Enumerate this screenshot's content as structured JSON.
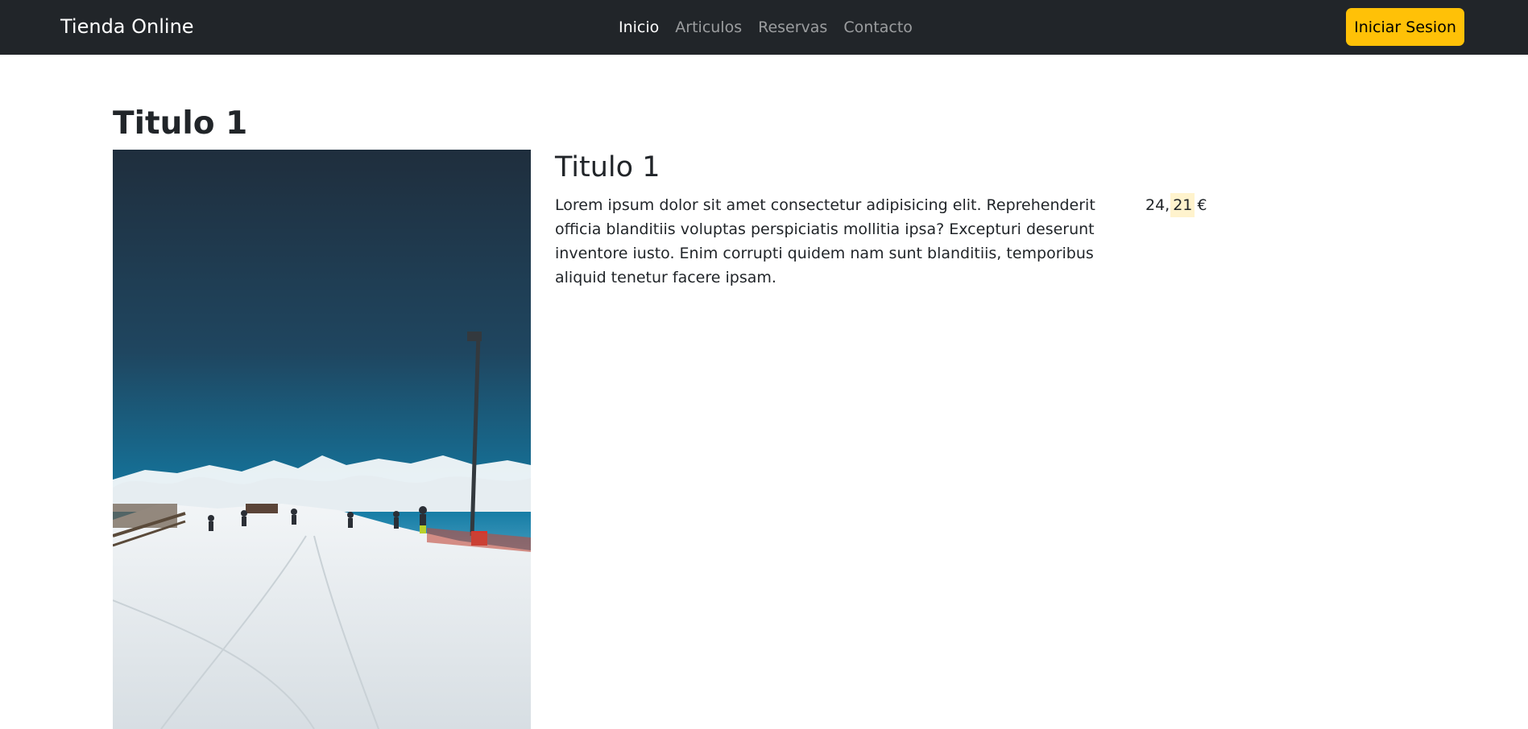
{
  "navbar": {
    "brand": "Tienda Online",
    "links": [
      {
        "label": "Inicio",
        "active": true
      },
      {
        "label": "Articulos",
        "active": false
      },
      {
        "label": "Reservas",
        "active": false
      },
      {
        "label": "Contacto",
        "active": false
      }
    ],
    "login_label": "Iniciar Sesion"
  },
  "page": {
    "heading": "Titulo 1"
  },
  "product": {
    "image_icon": "ski-slope-photo",
    "title": "Titulo 1",
    "description": "Lorem ipsum dolor sit amet consectetur adipisicing elit. Reprehenderit officia blanditiis voluptas perspiciatis mollitia ipsa? Excepturi deserunt inventore iusto. Enim corrupti quidem nam sunt blanditiis, temporibus aliquid tenetur facere ipsam.",
    "price": {
      "integer": "24,",
      "decimal": "21",
      "currency": "€"
    }
  },
  "colors": {
    "navbar_bg": "#212529",
    "accent": "#ffc107",
    "text": "#212529",
    "price_highlight": "#fff3cd"
  }
}
